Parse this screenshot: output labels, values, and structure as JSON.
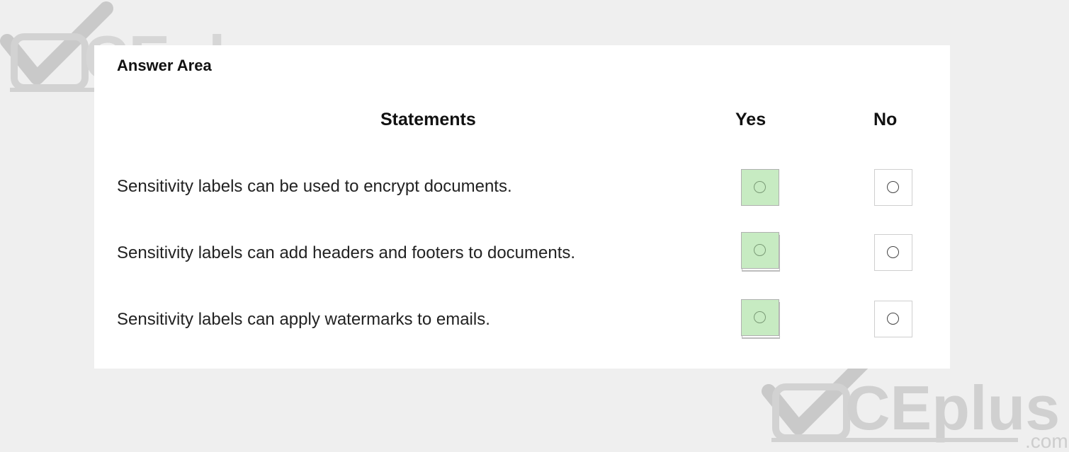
{
  "answer_area": {
    "title": "Answer Area",
    "headers": {
      "statements": "Statements",
      "yes": "Yes",
      "no": "No"
    },
    "rows": [
      {
        "statement": "Sensitivity labels can be used to encrypt documents.",
        "selected": "Yes"
      },
      {
        "statement": "Sensitivity labels can add headers and footers to documents.",
        "selected": "Yes"
      },
      {
        "statement": "Sensitivity labels can apply watermarks to emails.",
        "selected": "Yes"
      }
    ]
  },
  "watermark": {
    "text": "CEplus",
    "suffix": ".com"
  },
  "colors": {
    "selected_fill": "#c7ebc2",
    "page_bg": "#efefef",
    "panel_bg": "#ffffff"
  }
}
